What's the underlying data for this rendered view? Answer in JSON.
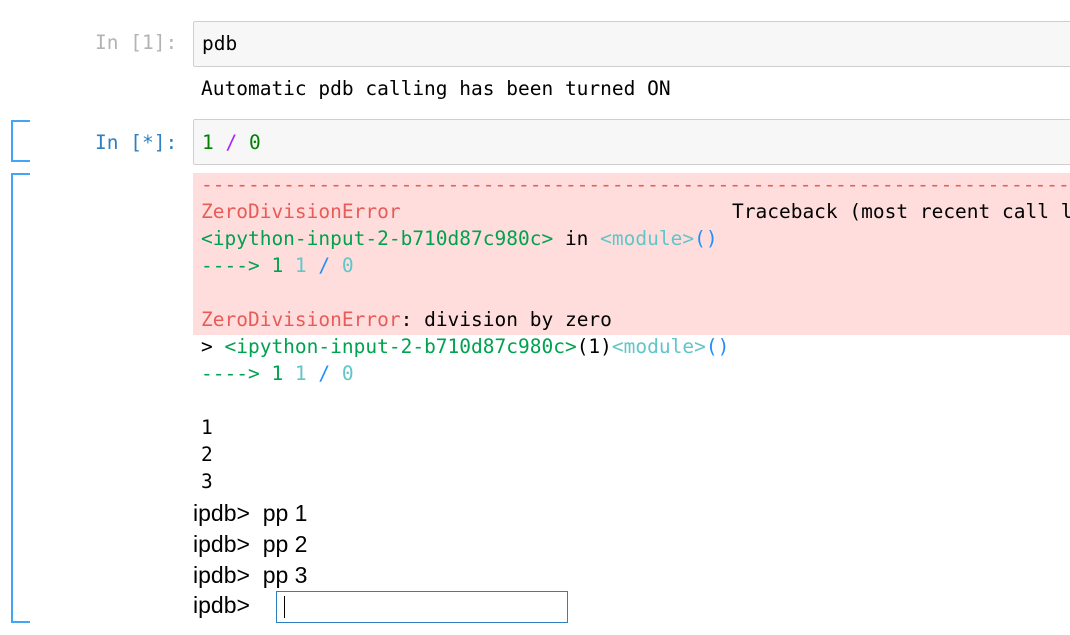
{
  "cell1": {
    "prompt": "In [1]:",
    "code": "pdb",
    "output": "Automatic pdb calling has been turned ON"
  },
  "cell2": {
    "prompt": "In [*]:",
    "code_num1": "1",
    "code_op": "/",
    "code_num2": "0"
  },
  "traceback": {
    "dashes": "---------------------------------------------------------------------------",
    "error_name": "ZeroDivisionError",
    "traceback_header": "Traceback (most recent call last)",
    "input_ref": "<ipython-input-2-b710d87c980c>",
    "in_word": " in ",
    "module": "<module>",
    "parens": "()",
    "arrow": "----> 1 ",
    "arrow_code_1": "1",
    "arrow_code_op": " / ",
    "arrow_code_0": "0",
    "error_name2": "ZeroDivisionError",
    "error_msg": ": division by zero"
  },
  "debug": {
    "marker": "> ",
    "input_ref": "<ipython-input-2-b710d87c980c>",
    "lineno": "(1)",
    "module": "<module>",
    "parens": "()",
    "arrow": "----> 1 ",
    "arrow_code_1": "1",
    "arrow_code_op": " / ",
    "arrow_code_0": "0"
  },
  "printed": [
    "1",
    "2",
    "3"
  ],
  "ipdb_lines": [
    "ipdb>  pp 1",
    "ipdb>  pp 2",
    "ipdb>  pp 3"
  ],
  "ipdb_prompt": "ipdb>",
  "ipdb_input_value": ""
}
